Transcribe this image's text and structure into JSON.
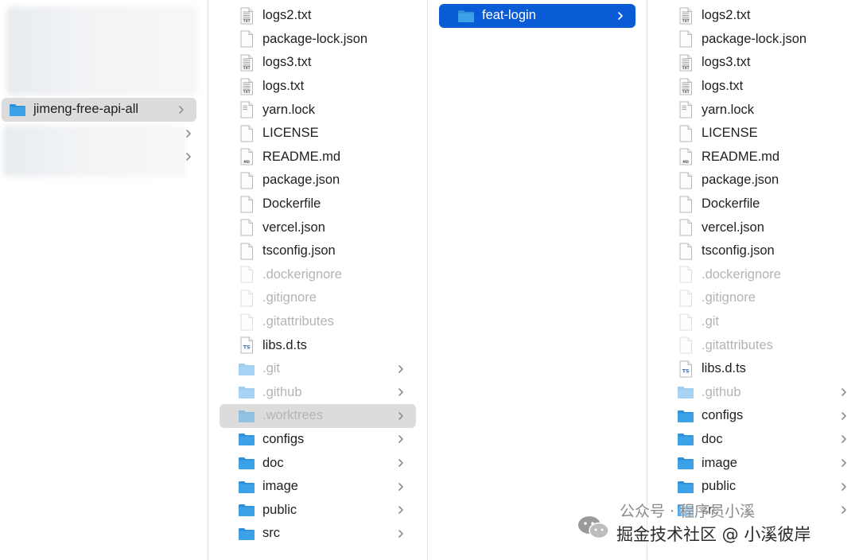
{
  "colors": {
    "folder": "#3da1e8",
    "selection_blue": "#0a5bd6",
    "selection_gray": "#dcdcdc",
    "dim_text": "#b4b4b4"
  },
  "column1": {
    "items": [
      {
        "name": "jimeng-free-api-all",
        "kind": "folder",
        "state": "selected-inactive",
        "chevron": true
      }
    ]
  },
  "column2": {
    "items": [
      {
        "name": "logs2.txt",
        "kind": "txt"
      },
      {
        "name": "package-lock.json",
        "kind": "doc"
      },
      {
        "name": "logs3.txt",
        "kind": "txt"
      },
      {
        "name": "logs.txt",
        "kind": "txt"
      },
      {
        "name": "yarn.lock",
        "kind": "lines"
      },
      {
        "name": "LICENSE",
        "kind": "blank"
      },
      {
        "name": "README.md",
        "kind": "md"
      },
      {
        "name": "package.json",
        "kind": "doc"
      },
      {
        "name": "Dockerfile",
        "kind": "blank"
      },
      {
        "name": "vercel.json",
        "kind": "doc"
      },
      {
        "name": "tsconfig.json",
        "kind": "doc"
      },
      {
        "name": ".dockerignore",
        "kind": "blank",
        "hidden": true
      },
      {
        "name": ".gitignore",
        "kind": "blank",
        "hidden": true
      },
      {
        "name": ".gitattributes",
        "kind": "blank",
        "hidden": true
      },
      {
        "name": "libs.d.ts",
        "kind": "ts"
      },
      {
        "name": ".git",
        "kind": "folder",
        "hidden": true,
        "chevron": true
      },
      {
        "name": ".github",
        "kind": "folder",
        "hidden": true,
        "chevron": true
      },
      {
        "name": ".worktrees",
        "kind": "folder",
        "hidden": true,
        "chevron": true,
        "state": "selected-inactive"
      },
      {
        "name": "configs",
        "kind": "folder",
        "chevron": true
      },
      {
        "name": "doc",
        "kind": "folder",
        "chevron": true
      },
      {
        "name": "image",
        "kind": "folder",
        "chevron": true
      },
      {
        "name": "public",
        "kind": "folder",
        "chevron": true
      },
      {
        "name": "src",
        "kind": "folder",
        "chevron": true
      }
    ]
  },
  "column3": {
    "items": [
      {
        "name": "feat-login",
        "kind": "folder",
        "chevron": true,
        "state": "selected-active"
      }
    ]
  },
  "column4": {
    "items": [
      {
        "name": "logs2.txt",
        "kind": "txt"
      },
      {
        "name": "package-lock.json",
        "kind": "doc"
      },
      {
        "name": "logs3.txt",
        "kind": "txt"
      },
      {
        "name": "logs.txt",
        "kind": "txt"
      },
      {
        "name": "yarn.lock",
        "kind": "lines"
      },
      {
        "name": "LICENSE",
        "kind": "blank"
      },
      {
        "name": "README.md",
        "kind": "md"
      },
      {
        "name": "package.json",
        "kind": "doc"
      },
      {
        "name": "Dockerfile",
        "kind": "blank"
      },
      {
        "name": "vercel.json",
        "kind": "doc"
      },
      {
        "name": "tsconfig.json",
        "kind": "doc"
      },
      {
        "name": ".dockerignore",
        "kind": "blank",
        "hidden": true
      },
      {
        "name": ".gitignore",
        "kind": "blank",
        "hidden": true
      },
      {
        "name": ".git",
        "kind": "blank",
        "hidden": true
      },
      {
        "name": ".gitattributes",
        "kind": "blank",
        "hidden": true
      },
      {
        "name": "libs.d.ts",
        "kind": "ts"
      },
      {
        "name": ".github",
        "kind": "folder",
        "hidden": true,
        "chevron": true
      },
      {
        "name": "configs",
        "kind": "folder",
        "chevron": true
      },
      {
        "name": "doc",
        "kind": "folder",
        "chevron": true
      },
      {
        "name": "image",
        "kind": "folder",
        "chevron": true
      },
      {
        "name": "public",
        "kind": "folder",
        "chevron": true
      },
      {
        "name": "src",
        "kind": "folder",
        "chevron": true
      }
    ]
  },
  "icon_labels": {
    "txt": "TXT",
    "md": "MD",
    "ts": "TS"
  },
  "watermark": {
    "line1": "公众号 · 程序员小溪",
    "line2": "掘金技术社区 @ 小溪彼岸"
  }
}
